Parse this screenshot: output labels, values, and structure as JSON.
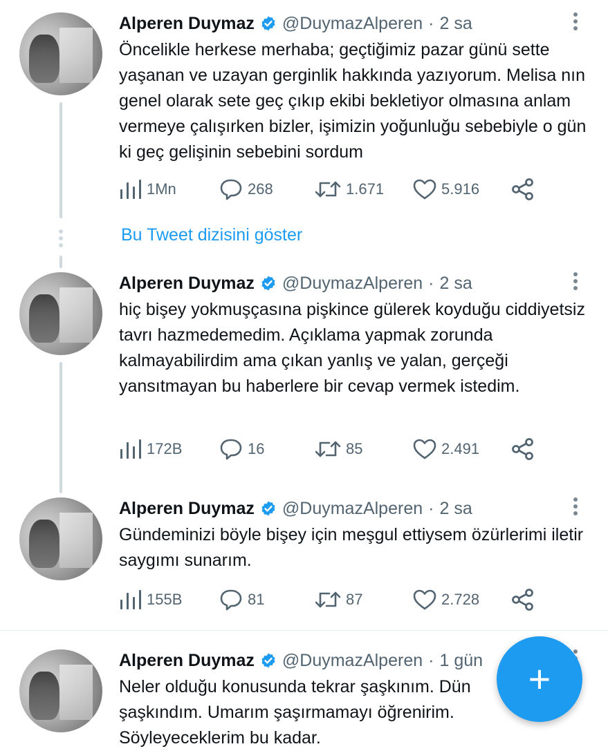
{
  "colors": {
    "accent": "#1d9bf0",
    "text": "#0f1419",
    "muted": "#536471",
    "line": "#cfd9de"
  },
  "tweets": [
    {
      "name": "Alperen Duymaz",
      "handle": "@DuymazAlperen",
      "dot": "·",
      "time": "2 sa",
      "text": "Öncelikle herkese merhaba; geçtiğimiz pazar günü sette yaşanan ve uzayan gerginlik hakkında yazıyorum. Melisa nın genel olarak sete geç çıkıp ekibi bekletiyor olmasına anlam vermeye çalışırken bizler, işimizin yoğunluğu sebebiyle o gün ki geç gelişinin sebebini sordum",
      "views": "1Mn",
      "replies": "268",
      "retweets": "1.671",
      "likes": "5.916"
    },
    {
      "name": "Alperen Duymaz",
      "handle": "@DuymazAlperen",
      "dot": "·",
      "time": "2 sa",
      "text": "hiç bişey yokmuşçasına pişkince gülerek koyduğu ciddiyetsiz tavrı hazmedemedim. Açıklama yapmak zorunda kalmayabilirdim ama çıkan yanlış ve yalan, gerçeği yansıtmayan bu haberlere bir cevap vermek istedim.",
      "views": "172B",
      "replies": "16",
      "retweets": "85",
      "likes": "2.491"
    },
    {
      "name": "Alperen Duymaz",
      "handle": "@DuymazAlperen",
      "dot": "·",
      "time": "2 sa",
      "text": "Gündeminizi böyle bişey için meşgul ettiysem özürlerimi iletir saygımı sunarım.",
      "views": "155B",
      "replies": "81",
      "retweets": "87",
      "likes": "2.728"
    },
    {
      "name": "Alperen Duymaz",
      "handle": "@DuymazAlperen",
      "dot": "·",
      "time": "1 gün",
      "text": "Neler olduğu konusunda tekrar şaşkınım. Dün şaşkındım. Umarım şaşırmamayı öğrenirim. Söyleyeceklerim bu kadar."
    }
  ],
  "show_thread_label": "Bu Tweet dizisini göster",
  "fab_label": "+",
  "icons": [
    "verified-icon",
    "more-icon",
    "views-icon",
    "reply-icon",
    "retweet-icon",
    "like-icon",
    "share-icon",
    "compose-icon"
  ]
}
